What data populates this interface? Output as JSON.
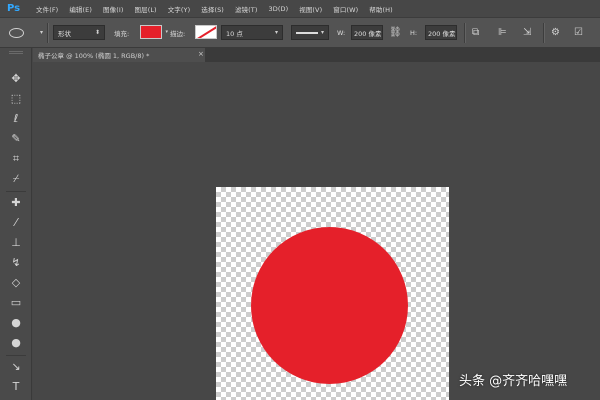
{
  "app": {
    "logo": "Ps"
  },
  "menu": [
    "文件(F)",
    "编辑(E)",
    "图像(I)",
    "图层(L)",
    "文字(Y)",
    "选择(S)",
    "滤镜(T)",
    "3D(D)",
    "视图(V)",
    "窗口(W)",
    "帮助(H)"
  ],
  "options": {
    "tool_icon": "ellipse-tool-icon",
    "mode": "形状",
    "fill_label": "填充:",
    "fill_color": "#e5202a",
    "stroke_label": "描边:",
    "stroke_color": "none",
    "stroke_width": "10 点",
    "w_label": "W:",
    "w_value": "200 像素",
    "h_label": "H:",
    "h_value": "200 像素"
  },
  "document": {
    "tab_title": "椭子公章 @ 100% (椭圆 1, RGB/8) *",
    "tab_close": "×"
  },
  "shape": {
    "fill": "#e5202a",
    "type": "circle"
  },
  "watermark": "头条 @齐齐哈嘿嘿"
}
